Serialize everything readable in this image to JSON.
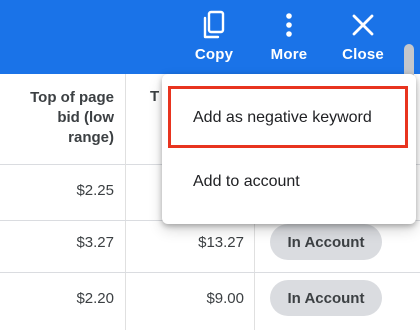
{
  "toolbar": {
    "copy_label": "Copy",
    "more_label": "More",
    "close_label": "Close",
    "background": "#1a73e8"
  },
  "table": {
    "header": {
      "top_of_page_bid_low_line1": "Top of page",
      "top_of_page_bid_low_line2": "bid (low",
      "top_of_page_bid_low_line3": "range)",
      "next_col_partial": "T"
    },
    "rows": [
      {
        "bid_low": "$2.25",
        "bid_high": "",
        "status": ""
      },
      {
        "bid_low": "$3.27",
        "bid_high": "$13.27",
        "status": "In Account"
      },
      {
        "bid_low": "$2.20",
        "bid_high": "$9.00",
        "status": "In Account"
      }
    ]
  },
  "menu": {
    "items": [
      {
        "label": "Add as negative keyword"
      },
      {
        "label": "Add to account"
      }
    ],
    "highlight_color": "#e8341f"
  },
  "icons": {
    "copy": "copy-icon",
    "more": "more-vert-icon",
    "close": "close-icon"
  }
}
